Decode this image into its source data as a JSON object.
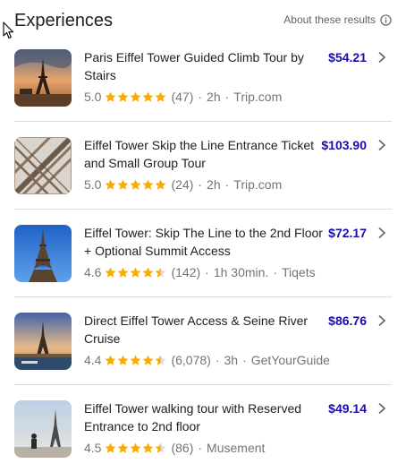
{
  "header": {
    "title": "Experiences",
    "about_label": "About these results"
  },
  "items": [
    {
      "name": "Paris Eiffel Tower Guided Climb Tour by Stairs",
      "price": "$54.21",
      "rating": "5.0",
      "rating_value": 5.0,
      "reviews": "(47)",
      "duration": "2h",
      "provider": "Trip.com",
      "sep1": "·",
      "sep2": "·"
    },
    {
      "name": "Eiffel Tower Skip the Line Entrance Ticket and Small Group Tour",
      "price": "$103.90",
      "rating": "5.0",
      "rating_value": 5.0,
      "reviews": "(24)",
      "duration": "2h",
      "provider": "Trip.com",
      "sep1": "·",
      "sep2": "·"
    },
    {
      "name": "Eiffel Tower: Skip The Line to the 2nd Floor + Optional Summit Access",
      "price": "$72.17",
      "rating": "4.6",
      "rating_value": 4.6,
      "reviews": "(142)",
      "duration": "1h 30min.",
      "provider": "Tiqets",
      "sep1": "·",
      "sep2": "·"
    },
    {
      "name": "Direct Eiffel Tower Access & Seine River Cruise",
      "price": "$86.76",
      "rating": "4.4",
      "rating_value": 4.4,
      "reviews": "(6,078)",
      "duration": "3h",
      "provider": "GetYourGuide",
      "sep1": "·",
      "sep2": "·"
    },
    {
      "name": "Eiffel Tower walking tour with Reserved Entrance to 2nd floor",
      "price": "$49.14",
      "rating": "4.5",
      "rating_value": 4.5,
      "reviews": "(86)",
      "duration": "",
      "provider": "Musement",
      "sep1": "·",
      "sep2": ""
    }
  ],
  "colors": {
    "star": "#f9ab00",
    "star_empty": "#dadce0",
    "price": "#1a0dab",
    "meta": "#70757a"
  },
  "icons": {
    "info": "info-icon",
    "chevron": "chevron-right-icon",
    "star": "star-icon",
    "cursor": "mouse-pointer-icon"
  }
}
